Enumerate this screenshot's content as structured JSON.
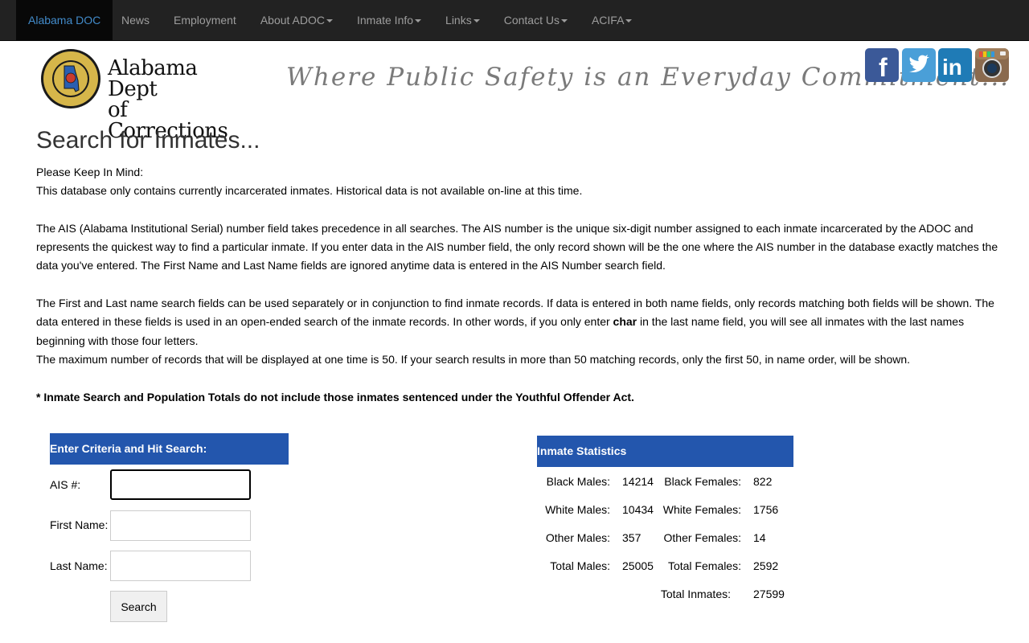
{
  "nav": {
    "brand": "Alabama DOC",
    "items": [
      {
        "label": "News",
        "dropdown": false
      },
      {
        "label": "Employment",
        "dropdown": false
      },
      {
        "label": "About ADOC",
        "dropdown": true
      },
      {
        "label": "Inmate Info",
        "dropdown": true
      },
      {
        "label": "Links",
        "dropdown": true
      },
      {
        "label": "Contact Us",
        "dropdown": true
      },
      {
        "label": "ACIFA",
        "dropdown": true
      }
    ]
  },
  "header": {
    "logo_line1": "Alabama Dept",
    "logo_line2": "of Corrections",
    "seal_text": "DEPARTMENT OF CORRECTIONS",
    "tagline": "Where Public Safety is an Everyday Commitment..."
  },
  "social": {
    "facebook_glyph": "f",
    "linkedin_glyph": "in",
    "colors": {
      "facebook": "#3b5998",
      "twitter": "#4a9fd8",
      "linkedin": "#1f7bb6",
      "instagram": "#8a6a4e"
    }
  },
  "page": {
    "title": "Search for Inmates...",
    "keep_in_mind": "Please Keep In Mind:",
    "p1": "This database only contains currently incarcerated inmates. Historical data is not available on-line at this time.",
    "p2": "The AIS (Alabama Institutional Serial) number field takes precedence in all searches. The AIS number is the unique six-digit number assigned to each inmate incarcerated by the ADOC and represents the quickest way to find a particular inmate. If you enter data in the AIS number field, the only record shown will be the one where the AIS number in the database exactly matches the data you've entered. The First Name and Last Name fields are ignored anytime data is entered in the AIS Number search field.",
    "p3_part1": "The First and Last name search fields can be used separately or in conjunction to find inmate records. If data is entered in both name fields, only records matching both fields will be shown. The data entered in these fields is used in an open-ended search of the inmate records. In other words, if you only enter ",
    "p3_bold": "char",
    "p3_part2": " in the last name field, you will see all inmates with the last names beginning with those four letters.",
    "p4": "The maximum number of records that will be displayed at one time is 50. If your search results in more than 50 matching records, only the first 50, in name order, will be shown.",
    "note": "* Inmate Search and Population Totals do not include those inmates sentenced under the Youthful Offender Act."
  },
  "search_form": {
    "header": "Enter Criteria and Hit Search:",
    "ais_label": "AIS #:",
    "first_label": "First Name:",
    "last_label": "Last Name:",
    "ais_value": "",
    "first_value": "",
    "last_value": "",
    "button": "Search"
  },
  "stats": {
    "header": "Inmate Statistics",
    "black_males_label": "Black Males:",
    "black_males": "14214",
    "black_females_label": "Black Females:",
    "black_females": "822",
    "white_males_label": "White Males:",
    "white_males": "10434",
    "white_females_label": "White Females:",
    "white_females": "1756",
    "other_males_label": "Other Males:",
    "other_males": "357",
    "other_females_label": "Other Females:",
    "other_females": "14",
    "total_males_label": "Total Males:",
    "total_males": "25005",
    "total_females_label": "Total Females:",
    "total_females": "2592",
    "total_inmates_label": "Total Inmates:",
    "total_inmates": "27599"
  },
  "colors": {
    "nav_bg": "#222222",
    "panel_blue": "#2356ad",
    "brand_link": "#428bca"
  }
}
